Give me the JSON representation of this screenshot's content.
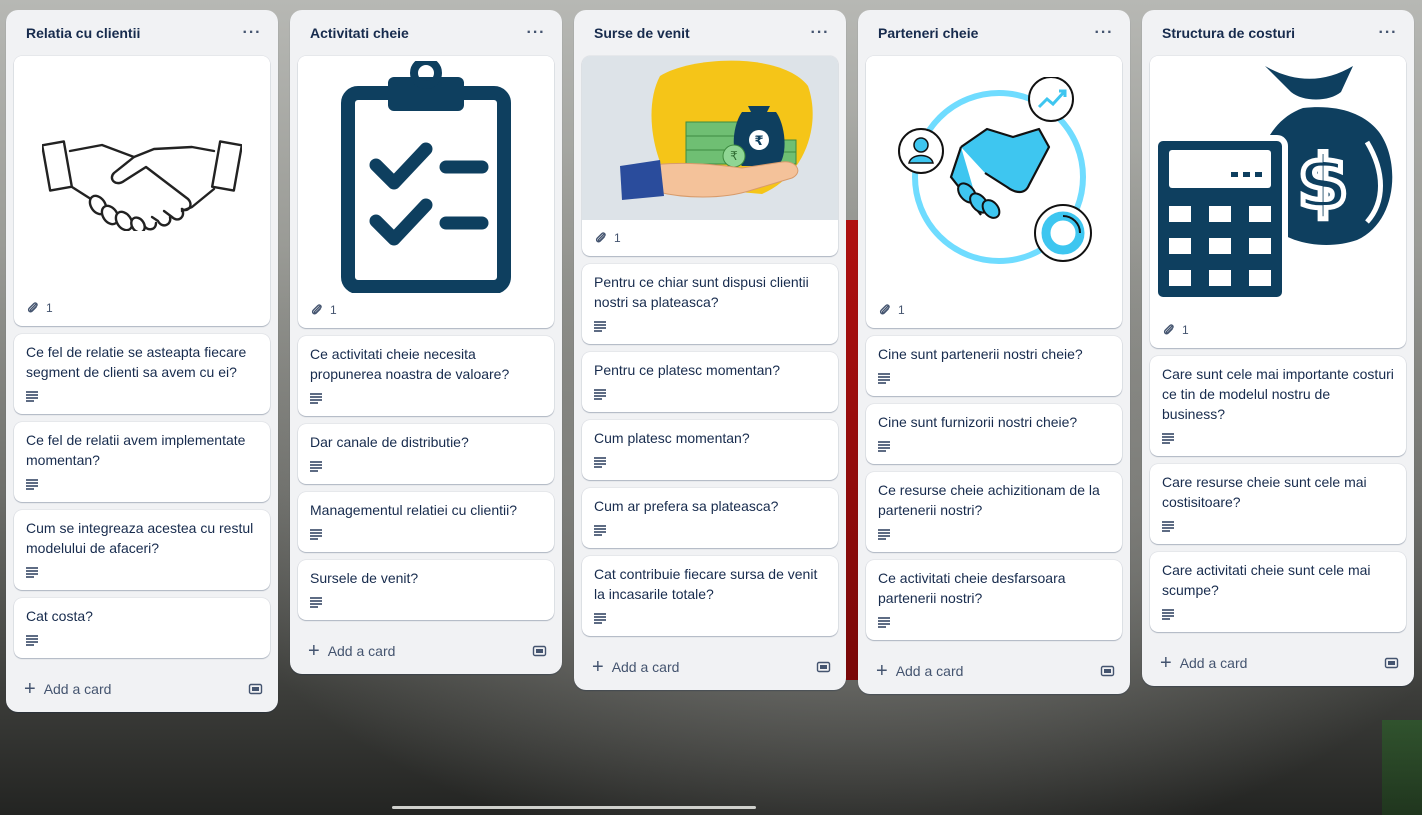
{
  "lists": [
    {
      "title": "Relatia cu clientii",
      "menu": "···",
      "cover_attachments": "1",
      "cards": [
        "Ce fel de relatie se asteapta fiecare segment de clienti sa avem cu ei?",
        "Ce fel de relatii avem implementate momentan?",
        "Cum se integreaza acestea cu restul modelului de afaceri?",
        "Cat costa?"
      ],
      "add_label": "Add a card"
    },
    {
      "title": "Activitati cheie",
      "menu": "···",
      "cover_attachments": "1",
      "cards": [
        "Ce activitati cheie necesita propunerea noastra de valoare?",
        "Dar canale de distributie?",
        "Managementul relatiei cu clientii?",
        "Sursele de venit?"
      ],
      "add_label": "Add a card"
    },
    {
      "title": "Surse de venit",
      "menu": "···",
      "cover_attachments": "1",
      "cards": [
        "Pentru ce chiar sunt dispusi clientii nostri sa plateasca?",
        "Pentru ce platesc momentan?",
        "Cum platesc momentan?",
        "Cum ar prefera sa plateasca?",
        "Cat contribuie fiecare sursa de venit la incasarile totale?"
      ],
      "add_label": "Add a card"
    },
    {
      "title": "Parteneri cheie",
      "menu": "···",
      "cover_attachments": "1",
      "cards": [
        "Cine sunt partenerii nostri cheie?",
        "Cine sunt furnizorii nostri cheie?",
        "Ce resurse cheie achizitionam de la partenerii nostri?",
        "Ce activitati cheie desfarsoara partenerii nostri?"
      ],
      "add_label": "Add a card"
    },
    {
      "title": "Structura de costuri",
      "menu": "···",
      "cover_attachments": "1",
      "cards": [
        "Care sunt cele mai importante costuri ce tin de modelul nostru de business?",
        "Care resurse cheie sunt cele mai costisitoare?",
        "Care activitati cheie sunt cele mai scumpe?"
      ],
      "add_label": "Add a card"
    }
  ],
  "icons": {
    "cover_images": [
      "handshake-illustration",
      "clipboard-checklist-illustration",
      "money-hand-illustration",
      "partners-handshake-illustration",
      "cost-calculator-moneybag-illustration"
    ],
    "badges": [
      "paperclip-icon",
      "description-icon"
    ],
    "footer": [
      "plus-icon",
      "card-template-icon"
    ]
  },
  "colors": {
    "list_bg": "#f1f2f4",
    "card_bg": "#ffffff",
    "title": "#172b4d",
    "navy": "#0e3f5f",
    "cyan": "#3ec6f0",
    "yellow": "#f5c518"
  }
}
